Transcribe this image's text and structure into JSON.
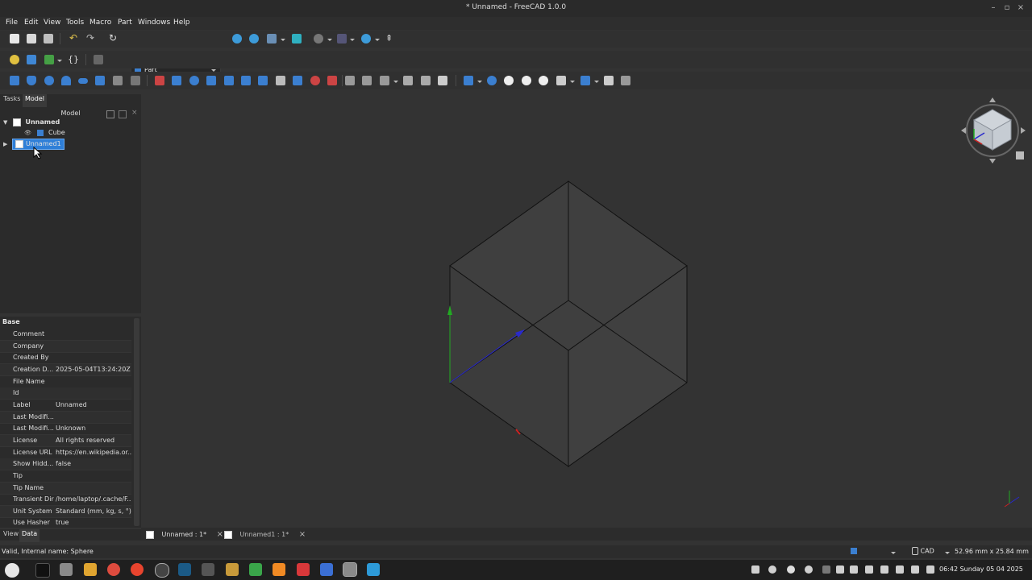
{
  "window": {
    "title": "* Unnamed - FreeCAD 1.0.0"
  },
  "menu": [
    "File",
    "Edit",
    "View",
    "Tools",
    "Macro",
    "Part",
    "Windows",
    "Help"
  ],
  "toolbar": {
    "workbench": "Part"
  },
  "combo": {
    "tabs": [
      "Tasks",
      "Model"
    ],
    "header": "Model",
    "tree": [
      {
        "label": "Unnamed",
        "bold": true
      },
      {
        "label": "Cube"
      },
      {
        "label": "Unnamed1",
        "selected": true
      }
    ]
  },
  "properties": {
    "group": "Base",
    "rows": [
      {
        "name": "Comment",
        "value": ""
      },
      {
        "name": "Company",
        "value": ""
      },
      {
        "name": "Created By",
        "value": ""
      },
      {
        "name": "Creation D...",
        "value": "2025-05-04T13:24:20Z"
      },
      {
        "name": "File Name",
        "value": ""
      },
      {
        "name": "Id",
        "value": ""
      },
      {
        "name": "Label",
        "value": "Unnamed"
      },
      {
        "name": "Last Modifi...",
        "value": ""
      },
      {
        "name": "Last Modifi...",
        "value": "Unknown"
      },
      {
        "name": "License",
        "value": "All rights reserved"
      },
      {
        "name": "License URL",
        "value": "https://en.wikipedia.or..."
      },
      {
        "name": "Show Hidd...",
        "value": "false"
      },
      {
        "name": "Tip",
        "value": ""
      },
      {
        "name": "Tip Name",
        "value": ""
      },
      {
        "name": "Transient Dir",
        "value": "/home/laptop/.cache/F..."
      },
      {
        "name": "Unit System",
        "value": "Standard (mm, kg, s, °)"
      },
      {
        "name": "Use Hasher",
        "value": "true"
      }
    ],
    "tabs": [
      "View",
      "Data"
    ]
  },
  "doc_tabs": [
    "Unnamed : 1*",
    "Unnamed1 : 1*"
  ],
  "status": {
    "message": "Valid, Internal name: Sphere",
    "nav_style": "CAD",
    "dimensions": "52.96 mm x 25.84 mm"
  },
  "taskbar": {
    "clock": "06:42 Sunday 05 04 2025"
  },
  "colors": {
    "selection": "#2f7fd8",
    "x_axis": "#cc2222",
    "y_axis": "#22aa22",
    "z_axis": "#2a2acc"
  }
}
